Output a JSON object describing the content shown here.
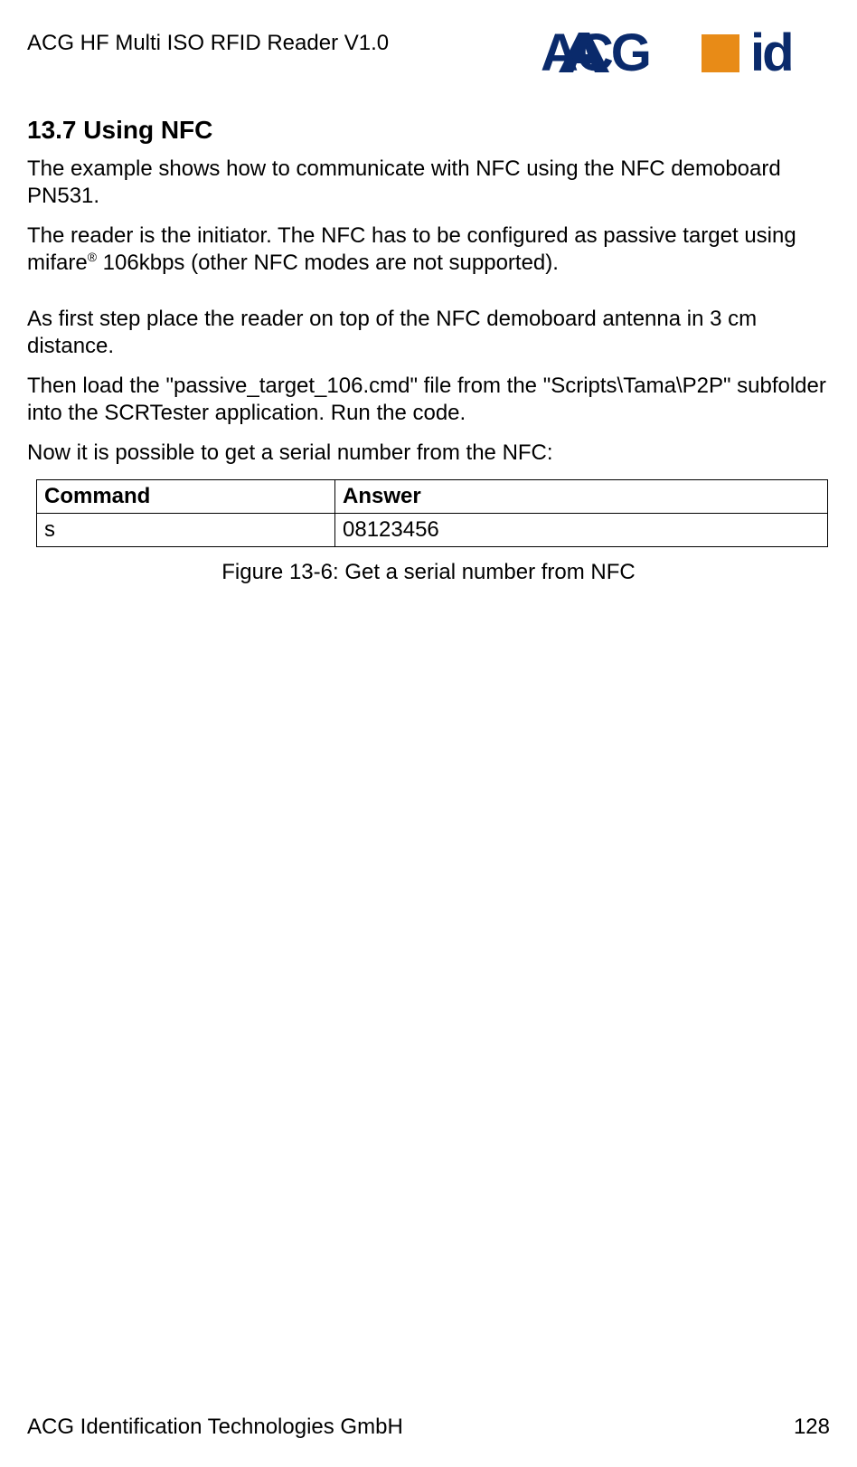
{
  "header": {
    "title": "ACG HF Multi ISO RFID Reader V1.0",
    "logo_text_main": "ACG",
    "logo_text_side": "id"
  },
  "section": {
    "heading": "13.7 Using NFC",
    "p1": "The example shows how to communicate with NFC using the NFC demoboard PN531.",
    "p2a": "The reader is the initiator. The NFC has to be configured as passive target using mifare",
    "p2b": " 106kbps (other NFC modes are not supported).",
    "p3": "As first step place the reader on top of the NFC demoboard antenna in 3 cm distance.",
    "p4": "Then load the \"passive_target_106.cmd\" file from the \"Scripts\\Tama\\P2P\" subfolder into the SCRTester application. Run the code.",
    "p5": "Now it is possible to get a serial number from the NFC:"
  },
  "table": {
    "h1": "Command",
    "h2": "Answer",
    "r1c1": "s",
    "r1c2": "08123456"
  },
  "caption": "Figure 13-6: Get a serial number from NFC",
  "footer": {
    "org": "ACG Identification Technologies GmbH",
    "page": "128"
  }
}
